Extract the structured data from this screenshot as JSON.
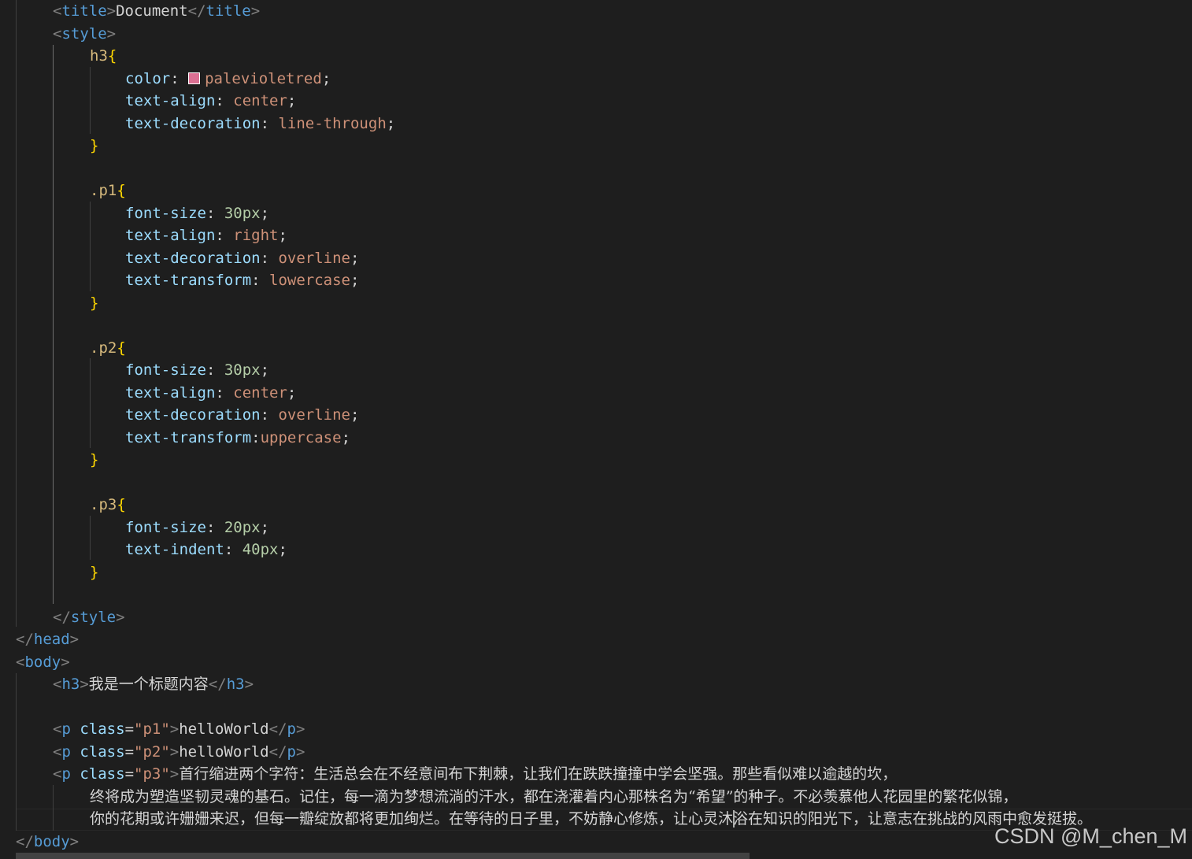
{
  "editor": {
    "theme_colors": {
      "background": "#1e1e1e",
      "tag": "#569cd6",
      "property": "#9cdcfe",
      "value": "#ce9178",
      "number": "#b5cea8",
      "selector": "#d7ba7d",
      "brace": "#ffd700"
    },
    "lines": [
      [
        {
          "t": "<",
          "c": "tag-punct"
        },
        {
          "t": "title",
          "c": "tag-name"
        },
        {
          "t": ">",
          "c": "tag-punct"
        },
        {
          "t": "Document",
          "c": "text"
        },
        {
          "t": "</",
          "c": "tag-punct"
        },
        {
          "t": "title",
          "c": "tag-name"
        },
        {
          "t": ">",
          "c": "tag-punct"
        }
      ],
      [
        {
          "t": "<",
          "c": "tag-punct"
        },
        {
          "t": "style",
          "c": "tag-name"
        },
        {
          "t": ">",
          "c": "tag-punct"
        }
      ],
      [
        {
          "t": "h3",
          "c": "selector"
        },
        {
          "t": "{",
          "c": "brace"
        }
      ],
      [
        {
          "t": "color",
          "c": "prop"
        },
        {
          "t": ": ",
          "c": "punct"
        },
        {
          "swatch": "#db7093"
        },
        {
          "t": "palevioletred",
          "c": "value"
        },
        {
          "t": ";",
          "c": "punct"
        }
      ],
      [
        {
          "t": "text-align",
          "c": "prop"
        },
        {
          "t": ": ",
          "c": "punct"
        },
        {
          "t": "center",
          "c": "value"
        },
        {
          "t": ";",
          "c": "punct"
        }
      ],
      [
        {
          "t": "text-decoration",
          "c": "prop"
        },
        {
          "t": ": ",
          "c": "punct"
        },
        {
          "t": "line-through",
          "c": "value"
        },
        {
          "t": ";",
          "c": "punct"
        }
      ],
      [
        {
          "t": "}",
          "c": "brace"
        }
      ],
      [],
      [
        {
          "t": ".p1",
          "c": "selector"
        },
        {
          "t": "{",
          "c": "brace"
        }
      ],
      [
        {
          "t": "font-size",
          "c": "prop"
        },
        {
          "t": ": ",
          "c": "punct"
        },
        {
          "t": "30px",
          "c": "number"
        },
        {
          "t": ";",
          "c": "punct"
        }
      ],
      [
        {
          "t": "text-align",
          "c": "prop"
        },
        {
          "t": ": ",
          "c": "punct"
        },
        {
          "t": "right",
          "c": "value"
        },
        {
          "t": ";",
          "c": "punct"
        }
      ],
      [
        {
          "t": "text-decoration",
          "c": "prop"
        },
        {
          "t": ": ",
          "c": "punct"
        },
        {
          "t": "overline",
          "c": "value"
        },
        {
          "t": ";",
          "c": "punct"
        }
      ],
      [
        {
          "t": "text-transform",
          "c": "prop"
        },
        {
          "t": ": ",
          "c": "punct"
        },
        {
          "t": "lowercase",
          "c": "value"
        },
        {
          "t": ";",
          "c": "punct"
        }
      ],
      [
        {
          "t": "}",
          "c": "brace"
        }
      ],
      [],
      [
        {
          "t": ".p2",
          "c": "selector"
        },
        {
          "t": "{",
          "c": "brace"
        }
      ],
      [
        {
          "t": "font-size",
          "c": "prop"
        },
        {
          "t": ": ",
          "c": "punct"
        },
        {
          "t": "30px",
          "c": "number"
        },
        {
          "t": ";",
          "c": "punct"
        }
      ],
      [
        {
          "t": "text-align",
          "c": "prop"
        },
        {
          "t": ": ",
          "c": "punct"
        },
        {
          "t": "center",
          "c": "value"
        },
        {
          "t": ";",
          "c": "punct"
        }
      ],
      [
        {
          "t": "text-decoration",
          "c": "prop"
        },
        {
          "t": ": ",
          "c": "punct"
        },
        {
          "t": "overline",
          "c": "value"
        },
        {
          "t": ";",
          "c": "punct"
        }
      ],
      [
        {
          "t": "text-transform",
          "c": "prop"
        },
        {
          "t": ":",
          "c": "punct"
        },
        {
          "t": "uppercase",
          "c": "value"
        },
        {
          "t": ";",
          "c": "punct"
        }
      ],
      [
        {
          "t": "}",
          "c": "brace"
        }
      ],
      [],
      [
        {
          "t": ".p3",
          "c": "selector"
        },
        {
          "t": "{",
          "c": "brace"
        }
      ],
      [
        {
          "t": "font-size",
          "c": "prop"
        },
        {
          "t": ": ",
          "c": "punct"
        },
        {
          "t": "20px",
          "c": "number"
        },
        {
          "t": ";",
          "c": "punct"
        }
      ],
      [
        {
          "t": "text-indent",
          "c": "prop"
        },
        {
          "t": ": ",
          "c": "punct"
        },
        {
          "t": "40px",
          "c": "number"
        },
        {
          "t": ";",
          "c": "punct"
        }
      ],
      [
        {
          "t": "}",
          "c": "brace"
        }
      ],
      [],
      [
        {
          "t": "</",
          "c": "tag-punct"
        },
        {
          "t": "style",
          "c": "tag-name"
        },
        {
          "t": ">",
          "c": "tag-punct"
        }
      ],
      [
        {
          "t": "</",
          "c": "tag-punct"
        },
        {
          "t": "head",
          "c": "tag-name"
        },
        {
          "t": ">",
          "c": "tag-punct"
        }
      ],
      [
        {
          "t": "<",
          "c": "tag-punct"
        },
        {
          "t": "body",
          "c": "tag-name"
        },
        {
          "t": ">",
          "c": "tag-punct"
        }
      ],
      [
        {
          "t": "<",
          "c": "tag-punct"
        },
        {
          "t": "h3",
          "c": "tag-name"
        },
        {
          "t": ">",
          "c": "tag-punct"
        },
        {
          "t": "我是一个标题内容",
          "c": "text cjk"
        },
        {
          "t": "</",
          "c": "tag-punct"
        },
        {
          "t": "h3",
          "c": "tag-name"
        },
        {
          "t": ">",
          "c": "tag-punct"
        }
      ],
      [],
      [
        {
          "t": "<",
          "c": "tag-punct"
        },
        {
          "t": "p",
          "c": "tag-name"
        },
        {
          "t": " ",
          "c": "text"
        },
        {
          "t": "class",
          "c": "attr"
        },
        {
          "t": "=",
          "c": "punct"
        },
        {
          "t": "\"p1\"",
          "c": "str"
        },
        {
          "t": ">",
          "c": "tag-punct"
        },
        {
          "t": "helloWorld",
          "c": "text"
        },
        {
          "t": "</",
          "c": "tag-punct"
        },
        {
          "t": "p",
          "c": "tag-name"
        },
        {
          "t": ">",
          "c": "tag-punct"
        }
      ],
      [
        {
          "t": "<",
          "c": "tag-punct"
        },
        {
          "t": "p",
          "c": "tag-name"
        },
        {
          "t": " ",
          "c": "text"
        },
        {
          "t": "class",
          "c": "attr"
        },
        {
          "t": "=",
          "c": "punct"
        },
        {
          "t": "\"p2\"",
          "c": "str"
        },
        {
          "t": ">",
          "c": "tag-punct"
        },
        {
          "t": "helloWorld",
          "c": "text"
        },
        {
          "t": "</",
          "c": "tag-punct"
        },
        {
          "t": "p",
          "c": "tag-name"
        },
        {
          "t": ">",
          "c": "tag-punct"
        }
      ],
      [
        {
          "t": "<",
          "c": "tag-punct"
        },
        {
          "t": "p",
          "c": "tag-name"
        },
        {
          "t": " ",
          "c": "text"
        },
        {
          "t": "class",
          "c": "attr"
        },
        {
          "t": "=",
          "c": "punct"
        },
        {
          "t": "\"p3\"",
          "c": "str"
        },
        {
          "t": ">",
          "c": "tag-punct"
        },
        {
          "t": "首行缩进两个字符：生活总会在不经意间布下荆棘，让我们在跌跌撞撞中学会坚强。那些看似难以逾越的坎，",
          "c": "text cjk"
        }
      ],
      [
        {
          "t": "终将成为塑造坚韧灵魂的基石。记住，每一滴为梦想流淌的汗水，都在浇灌着内心那株名为“希望”的种子。不必羡慕他人花园里的繁花似锦，",
          "c": "text cjk"
        }
      ],
      [
        {
          "t": "你的花期或许姗姗来迟，但每一瓣绽放都将更加绚烂。在等待的日子里，不妨静心修炼，让心灵沐浴在知识的阳光下，让意志在挑战的风雨中愈发挺拔。",
          "c": "text cjk"
        }
      ],
      [
        {
          "t": "</",
          "c": "tag-punct"
        },
        {
          "t": "body",
          "c": "tag-name"
        },
        {
          "t": ">",
          "c": "tag-punct"
        }
      ]
    ]
  },
  "watermark": {
    "text": "CSDN @M_chen_M"
  }
}
